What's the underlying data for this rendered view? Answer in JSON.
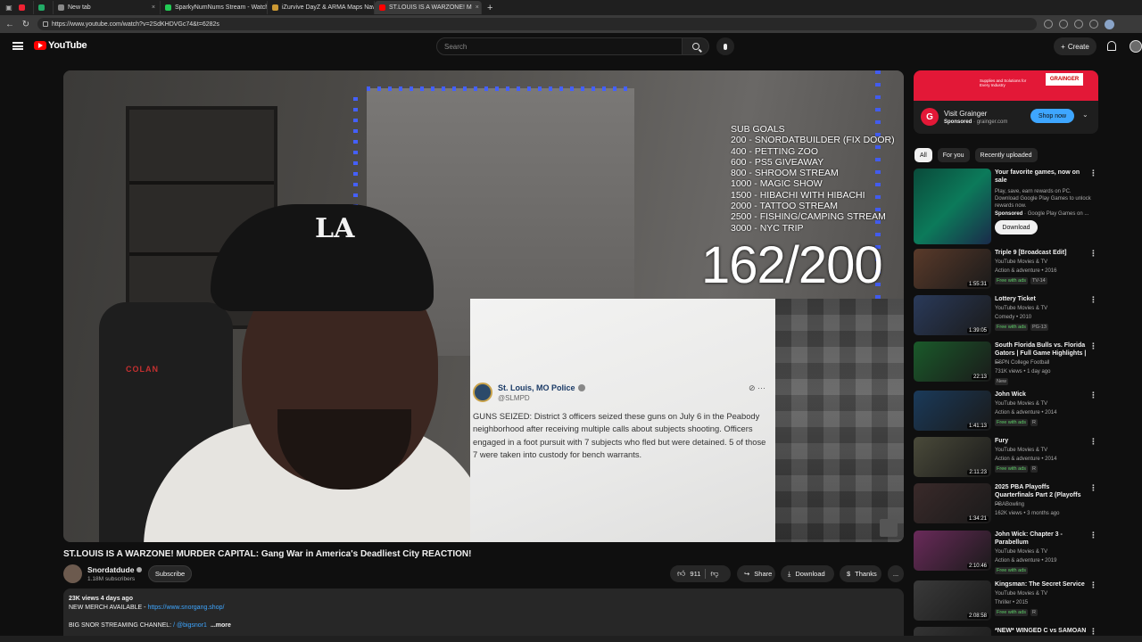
{
  "browser": {
    "tabs": [
      {
        "label": "",
        "color": "#e23",
        "active": false
      },
      {
        "label": "",
        "color": "#2a6",
        "active": false
      },
      {
        "label": "New tab",
        "color": "#888",
        "active": false
      },
      {
        "label": "SparkyNumNums Stream - Watch",
        "color": "#2c5",
        "active": false
      },
      {
        "label": "iZurvive DayZ & ARMA Maps Nav",
        "color": "#c93",
        "active": false
      },
      {
        "label": "ST.LOUIS IS A WARZONE! M",
        "color": "#f00",
        "active": true
      }
    ],
    "url": "https://www.youtube.com/watch?v=2SdKHDVGc74&t=6282s"
  },
  "header": {
    "logo_text": "YouTube",
    "search_placeholder": "Search",
    "create_label": "Create"
  },
  "video": {
    "sub_goals_heading": "SUB GOALS",
    "sub_goals": [
      "200 - SNORDATBUILDER (FIX DOOR)",
      "400 - PETTING ZOO",
      "600 - PS5 GIVEAWAY",
      "800 - SHROOM STREAM",
      "1000 - MAGIC SHOW",
      "1500 - HIBACHI WITH HIBACHI",
      "2000 - TATTOO STREAM",
      "2500 - FISHING/CAMPING STREAM",
      "3000 - NYC TRIP"
    ],
    "counter": "162/200",
    "chair_logo": "COLAN",
    "cap_logo": "LA",
    "tweet": {
      "name": "St. Louis, MO Police",
      "handle": "@SLMPD",
      "text": "GUNS SEIZED: District 3 officers seized these guns on July 6 in the Peabody neighborhood after receiving multiple calls about subjects shooting. Officers engaged in a foot pursuit with 7 subjects who fled but were detained. 5 of those 7 were taken into custody for bench warrants."
    }
  },
  "meta": {
    "title": "ST.LOUIS IS A WARZONE! MURDER CAPITAL: Gang War in America's Deadliest City REACTION!",
    "channel": "Snordatdude",
    "subscribers": "1.18M subscribers",
    "subscribe_label": "Subscribe",
    "likes": "911",
    "share_label": "Share",
    "download_label": "Download",
    "thanks_label": "Thanks",
    "more_label": "..."
  },
  "description": {
    "stats": "23K views  4 days ago",
    "merch_label": "NEW MERCH AVAILABLE - ",
    "merch_link": "https://www.snorgang.shop/",
    "channel_line": "BIG SNOR STREAMING CHANNEL: ",
    "channel_handle": "/ @bigsnor1",
    "more": "...more"
  },
  "ad": {
    "banner_text": "Supplies and Solutions for Every Industry",
    "banner_brand": "GRAINGER",
    "title": "Visit Grainger",
    "sponsored": "Sponsored",
    "domain": "grainger.com",
    "cta": "Shop now"
  },
  "chips": [
    "All",
    "For you",
    "Recently uploaded"
  ],
  "recommended_ad": {
    "title": "Your favorite games, now on sale",
    "desc": "Play, save, earn rewards on PC. Download Google Play Games to unlock rewards now.",
    "sponsored": "Sponsored",
    "advertiser": "Google Play Games on ...",
    "cta": "Download"
  },
  "recommendations": [
    {
      "title": "Triple 9 [Broadcast Edit]",
      "channel": "YouTube Movies & TV",
      "meta": "Action & adventure • 2016",
      "badges": [
        "Free with ads",
        "TV-14"
      ],
      "duration": "1:55:31",
      "color": "#5a3a2a"
    },
    {
      "title": "Lottery Ticket",
      "channel": "YouTube Movies & TV",
      "meta": "Comedy • 2010",
      "badges": [
        "Free with ads",
        "PG-13"
      ],
      "duration": "1:39:05",
      "color": "#2a3a5a"
    },
    {
      "title": "South Florida Bulls vs. Florida Gators | Full Game Highlights | ...",
      "channel": "ESPN College Football",
      "meta": "731K views • 1 day ago",
      "badges": [
        "New"
      ],
      "duration": "22:13",
      "color": "#1a5a2a"
    },
    {
      "title": "John Wick",
      "channel": "YouTube Movies & TV",
      "meta": "Action & adventure • 2014",
      "badges": [
        "Free with ads",
        "R"
      ],
      "duration": "1:41:13",
      "color": "#1a3a5a"
    },
    {
      "title": "Fury",
      "channel": "YouTube Movies & TV",
      "meta": "Action & adventure • 2014",
      "badges": [
        "Free with ads",
        "R"
      ],
      "duration": "2:11:23",
      "color": "#4a4a3a"
    },
    {
      "title": "2025 PBA Playoffs Quarterfinals Part 2 (Playoffs ...",
      "channel": "PBABowling",
      "meta": "162K views • 3 months ago",
      "badges": [],
      "duration": "1:34:21",
      "color": "#3a2a2a"
    },
    {
      "title": "John Wick: Chapter 3 - Parabellum",
      "channel": "YouTube Movies & TV",
      "meta": "Action & adventure • 2019",
      "badges": [
        "Free with ads"
      ],
      "duration": "2:10:46",
      "color": "#6a2a5a"
    },
    {
      "title": "Kingsman: The Secret Service",
      "channel": "YouTube Movies & TV",
      "meta": "Thriller • 2015",
      "badges": [
        "Free with ads",
        "R"
      ],
      "duration": "2:08:58",
      "color": "#3a3a3a"
    },
    {
      "title": "*NEW* WINGED C vs SAMOAN",
      "channel": "",
      "meta": "",
      "badges": [],
      "duration": "",
      "color": "#333"
    }
  ]
}
